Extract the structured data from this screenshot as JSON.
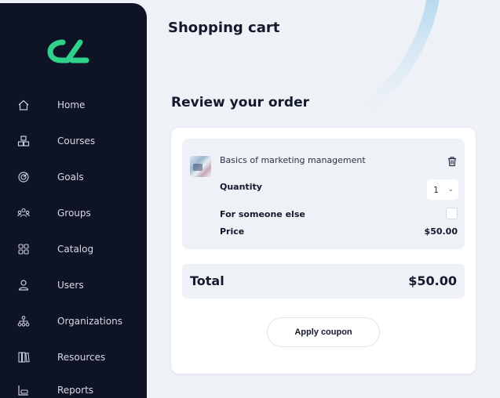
{
  "sidebar": {
    "logo_text": "cL",
    "items": [
      {
        "label": "Home",
        "icon": "home-icon"
      },
      {
        "label": "Courses",
        "icon": "courses-icon"
      },
      {
        "label": "Goals",
        "icon": "goals-icon"
      },
      {
        "label": "Groups",
        "icon": "groups-icon"
      },
      {
        "label": "Catalog",
        "icon": "catalog-icon"
      },
      {
        "label": "Users",
        "icon": "users-icon"
      },
      {
        "label": "Organizations",
        "icon": "organizations-icon"
      },
      {
        "label": "Resources",
        "icon": "resources-icon"
      },
      {
        "label": "Reports",
        "icon": "reports-icon"
      }
    ]
  },
  "page": {
    "title": "Shopping cart",
    "section_title": "Review your order"
  },
  "cart": {
    "item": {
      "name": "Basics of marketing management",
      "quantity_label": "Quantity",
      "quantity_value": "1",
      "for_someone_else_label": "For someone else",
      "price_label": "Price",
      "price_value": "$50.00"
    },
    "total_label": "Total",
    "total_value": "$50.00",
    "coupon_button": "Apply coupon"
  },
  "colors": {
    "sidebar_bg": "#0e1325",
    "logo_accent": "#2fd18b",
    "page_bg": "#eef1f6"
  }
}
